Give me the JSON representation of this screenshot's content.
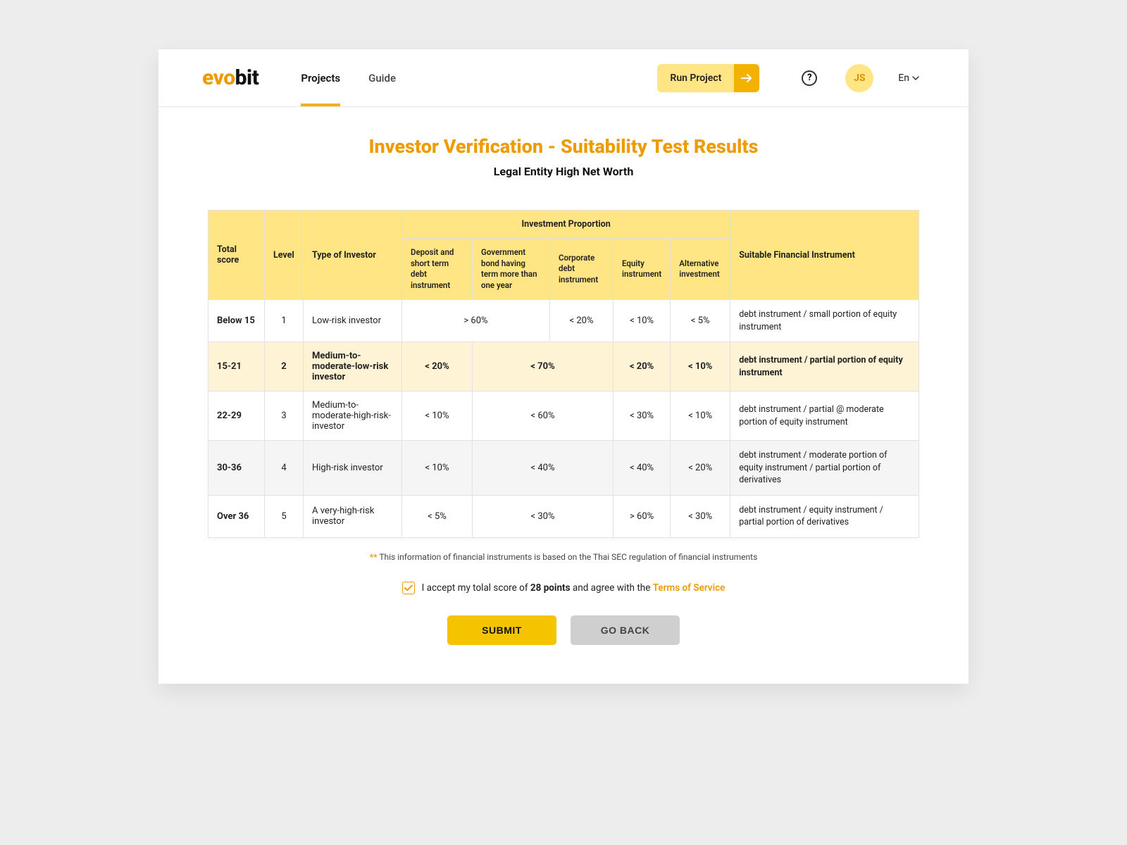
{
  "header": {
    "logo_evo": "evo",
    "logo_bit": "bit",
    "nav": {
      "projects": "Projects",
      "guide": "Guide"
    },
    "run_label": "Run Project",
    "avatar": "JS",
    "lang": "En"
  },
  "page": {
    "title": "Investor Verification - Suitability Test Results",
    "subtitle": "Legal Entity High Net Worth"
  },
  "table": {
    "headers": {
      "total_score": "Total score",
      "level": "Level",
      "type": "Type of Investor",
      "group": "Investment Proportion",
      "cols": {
        "deposit": "Deposit and short term debt instrument",
        "govbond": "Government bond having term more than one year",
        "corpdebt": "Corporate debt instrument",
        "equity": "Equity instrument",
        "alt": "Alternative investment"
      },
      "suitable": "Suitable Financial Instrument"
    },
    "rows": [
      {
        "score": "Below 15",
        "level": "1",
        "type": "Low-risk investor",
        "deposit_span": "> 60%",
        "corp": "< 20%",
        "equity": "< 10%",
        "alt": "< 5%",
        "fin": "debt instrument / small portion of equity instrument",
        "merge": "deposit_gov",
        "hl": false,
        "alt_row": false
      },
      {
        "score": "15-21",
        "level": "2",
        "type": "Medium-to-moderate-low-risk investor",
        "deposit": "< 20%",
        "gov_span": "< 70%",
        "equity": "< 20%",
        "alt": "< 10%",
        "fin": "debt instrument / partial portion of equity instrument",
        "merge": "gov_corp",
        "hl": true,
        "alt_row": false
      },
      {
        "score": "22-29",
        "level": "3",
        "type": "Medium-to-moderate-high-risk-investor",
        "deposit": "< 10%",
        "gov_span": "< 60%",
        "equity": "< 30%",
        "alt": "< 10%",
        "fin": "debt instrument / partial @ moderate portion of equity instrument",
        "merge": "gov_corp",
        "hl": false,
        "alt_row": false
      },
      {
        "score": "30-36",
        "level": "4",
        "type": "High-risk investor",
        "deposit": "< 10%",
        "gov_span": "< 40%",
        "equity": "< 40%",
        "alt": "< 20%",
        "fin": "debt instrument / moderate portion of equity instrument / partial portion of derivatives",
        "merge": "gov_corp",
        "hl": false,
        "alt_row": true
      },
      {
        "score": "Over 36",
        "level": "5",
        "type": "A very-high-risk investor",
        "deposit": "< 5%",
        "gov_span": "< 30%",
        "equity": "> 60%",
        "alt": "< 30%",
        "fin": "debt instrument / equity instrument / partial portion of derivatives",
        "merge": "gov_corp",
        "hl": false,
        "alt_row": false
      }
    ]
  },
  "note": {
    "stars": "**",
    "text": "This information of financial instruments is based on the Thai SEC regulation of financial instruments"
  },
  "accept": {
    "pre": "I accept my tolal score of ",
    "points": "28 points",
    "mid": " and agree with the ",
    "tos": "Terms of Service"
  },
  "buttons": {
    "submit": "SUBMIT",
    "back": "GO BACK"
  }
}
